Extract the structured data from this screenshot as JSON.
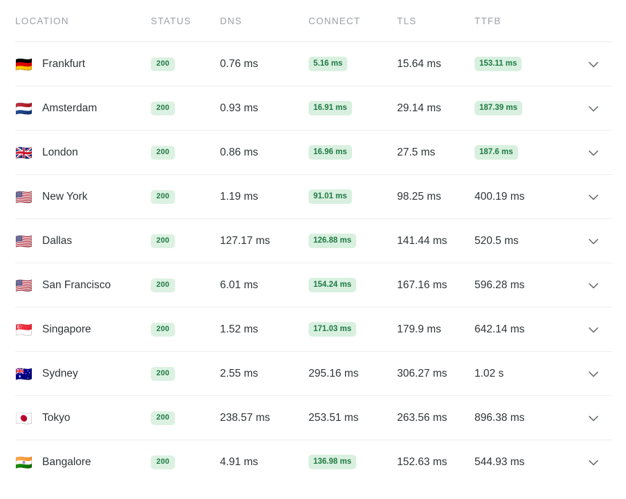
{
  "table": {
    "columns": [
      {
        "key": "location",
        "label": "LOCATION"
      },
      {
        "key": "status",
        "label": "STATUS"
      },
      {
        "key": "dns",
        "label": "DNS"
      },
      {
        "key": "connect",
        "label": "CONNECT"
      },
      {
        "key": "tls",
        "label": "TLS"
      },
      {
        "key": "ttfb",
        "label": "TTFB"
      }
    ],
    "colors": {
      "pill_background": "#d9f0e0",
      "pill_text": "#1f7a43",
      "status_background": "#dcf1e2",
      "status_text": "#1f7a43",
      "header_text": "#9ba1a6",
      "value_text": "#2f3437",
      "row_divider": "#eeeef0",
      "chevron": "#6e7479"
    },
    "expand_icon": "chevron-down-icon",
    "rows": [
      {
        "flag": "🇩🇪",
        "flag_name": "flag-germany",
        "location": "Frankfurt",
        "status": "200",
        "dns": "0.76 ms",
        "connect": "5.16 ms",
        "connect_highlight": true,
        "tls": "15.64 ms",
        "tls_highlight": false,
        "ttfb": "153.11 ms",
        "ttfb_highlight": true
      },
      {
        "flag": "🇳🇱",
        "flag_name": "flag-netherlands",
        "location": "Amsterdam",
        "status": "200",
        "dns": "0.93 ms",
        "connect": "16.91 ms",
        "connect_highlight": true,
        "tls": "29.14 ms",
        "tls_highlight": false,
        "ttfb": "187.39 ms",
        "ttfb_highlight": true
      },
      {
        "flag": "🇬🇧",
        "flag_name": "flag-united-kingdom",
        "location": "London",
        "status": "200",
        "dns": "0.86 ms",
        "connect": "16.96 ms",
        "connect_highlight": true,
        "tls": "27.5 ms",
        "tls_highlight": false,
        "ttfb": "187.6 ms",
        "ttfb_highlight": true
      },
      {
        "flag": "🇺🇸",
        "flag_name": "flag-united-states",
        "location": "New York",
        "status": "200",
        "dns": "1.19 ms",
        "connect": "91.01 ms",
        "connect_highlight": true,
        "tls": "98.25 ms",
        "tls_highlight": false,
        "ttfb": "400.19 ms",
        "ttfb_highlight": false
      },
      {
        "flag": "🇺🇸",
        "flag_name": "flag-united-states",
        "location": "Dallas",
        "status": "200",
        "dns": "127.17 ms",
        "connect": "126.88 ms",
        "connect_highlight": true,
        "tls": "141.44 ms",
        "tls_highlight": false,
        "ttfb": "520.5 ms",
        "ttfb_highlight": false
      },
      {
        "flag": "🇺🇸",
        "flag_name": "flag-united-states",
        "location": "San Francisco",
        "status": "200",
        "dns": "6.01 ms",
        "connect": "154.24 ms",
        "connect_highlight": true,
        "tls": "167.16 ms",
        "tls_highlight": false,
        "ttfb": "596.28 ms",
        "ttfb_highlight": false
      },
      {
        "flag": "🇸🇬",
        "flag_name": "flag-singapore",
        "location": "Singapore",
        "status": "200",
        "dns": "1.52 ms",
        "connect": "171.03 ms",
        "connect_highlight": true,
        "tls": "179.9 ms",
        "tls_highlight": false,
        "ttfb": "642.14 ms",
        "ttfb_highlight": false
      },
      {
        "flag": "🇦🇺",
        "flag_name": "flag-australia",
        "location": "Sydney",
        "status": "200",
        "dns": "2.55 ms",
        "connect": "295.16 ms",
        "connect_highlight": false,
        "tls": "306.27 ms",
        "tls_highlight": false,
        "ttfb": "1.02 s",
        "ttfb_highlight": false
      },
      {
        "flag": "🇯🇵",
        "flag_name": "flag-japan",
        "location": "Tokyo",
        "status": "200",
        "dns": "238.57 ms",
        "connect": "253.51 ms",
        "connect_highlight": false,
        "tls": "263.56 ms",
        "tls_highlight": false,
        "ttfb": "896.38 ms",
        "ttfb_highlight": false
      },
      {
        "flag": "🇮🇳",
        "flag_name": "flag-india",
        "location": "Bangalore",
        "status": "200",
        "dns": "4.91 ms",
        "connect": "136.98 ms",
        "connect_highlight": true,
        "tls": "152.63 ms",
        "tls_highlight": false,
        "ttfb": "544.93 ms",
        "ttfb_highlight": false
      }
    ]
  }
}
